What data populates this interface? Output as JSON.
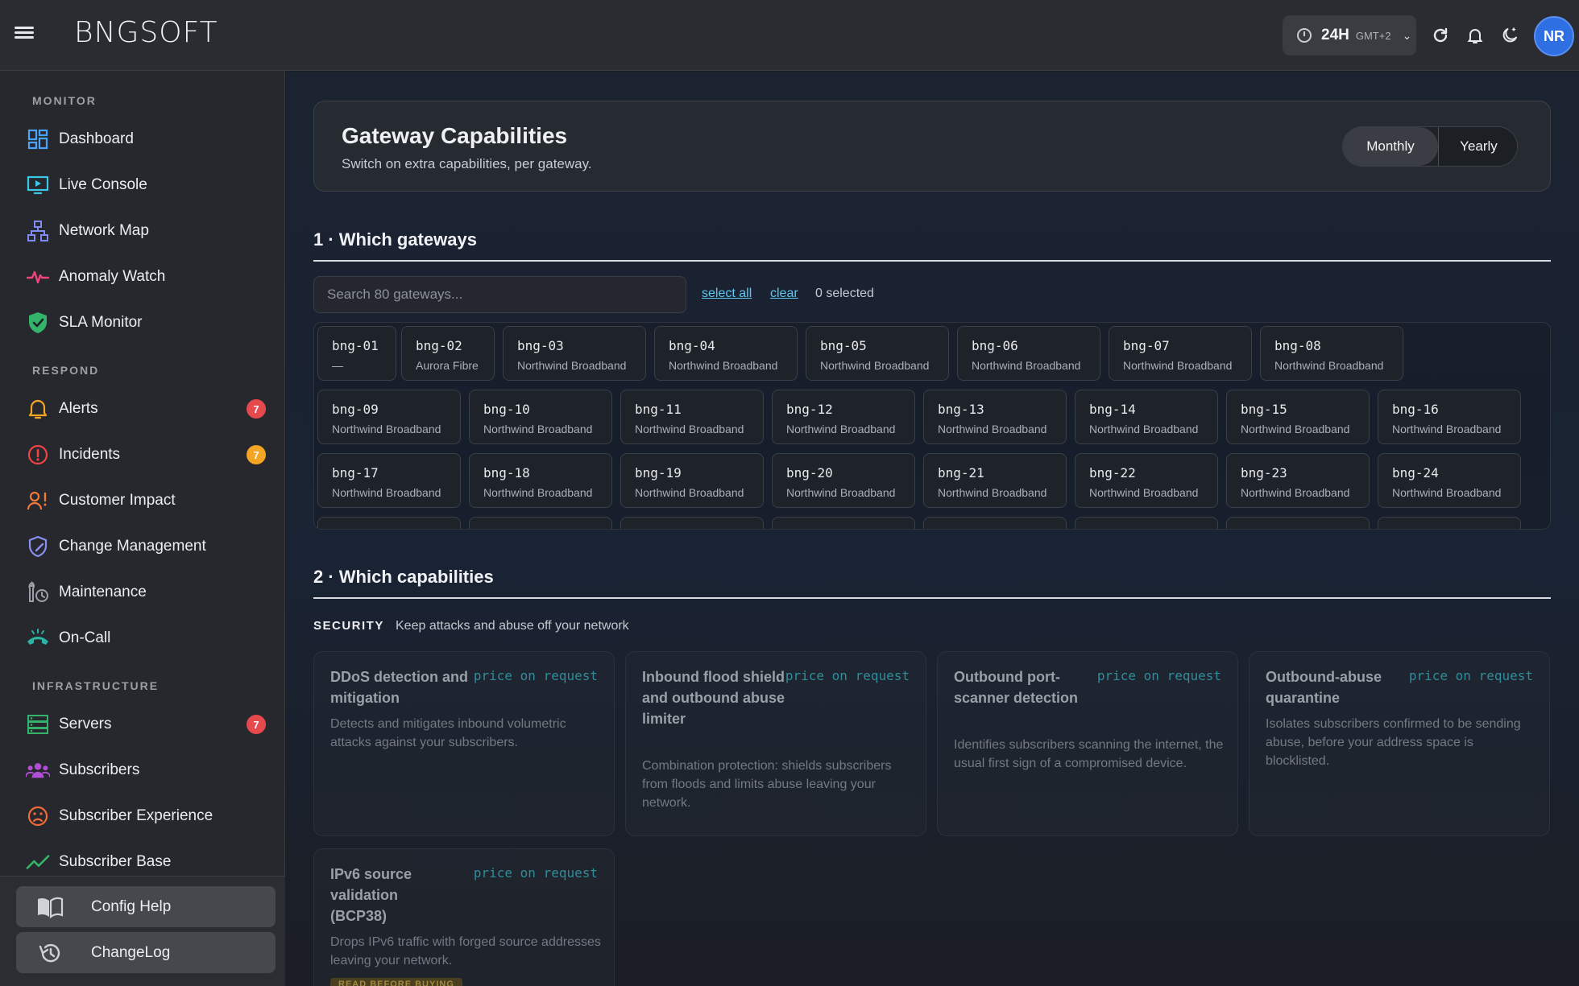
{
  "app": {
    "brand": "BNGSOFT"
  },
  "topbar": {
    "time_range": "24H",
    "timezone": "GMT+2",
    "avatar_initials": "NR"
  },
  "sidebar": {
    "sections": [
      {
        "title": "MONITOR"
      },
      {
        "title": "RESPOND"
      },
      {
        "title": "INFRASTRUCTURE"
      }
    ],
    "items": [
      {
        "label": "Dashboard",
        "icon": "dashboard-icon"
      },
      {
        "label": "Live Console",
        "icon": "monitor-play-icon"
      },
      {
        "label": "Network Map",
        "icon": "network-icon"
      },
      {
        "label": "Anomaly Watch",
        "icon": "pulse-icon"
      },
      {
        "label": "SLA Monitor",
        "icon": "shield-check-icon"
      },
      {
        "label": "Alerts",
        "icon": "bell-icon",
        "badge": "7",
        "badge_color": "#e5484d"
      },
      {
        "label": "Incidents",
        "icon": "alert-circle-icon",
        "badge": "7",
        "badge_color": "#f5a524"
      },
      {
        "label": "Customer Impact",
        "icon": "user-alert-icon"
      },
      {
        "label": "Change Management",
        "icon": "shield-edit-icon"
      },
      {
        "label": "Maintenance",
        "icon": "wrench-clock-icon"
      },
      {
        "label": "On-Call",
        "icon": "phone-icon"
      },
      {
        "label": "Servers",
        "icon": "server-icon",
        "badge": "7",
        "badge_color": "#e5484d"
      },
      {
        "label": "Subscribers",
        "icon": "users-icon"
      },
      {
        "label": "Subscriber Experience",
        "icon": "sad-face-icon"
      },
      {
        "label": "Subscriber Base",
        "icon": "trend-up-icon"
      }
    ],
    "bottom": [
      {
        "label": "Config Help",
        "icon": "book-icon"
      },
      {
        "label": "ChangeLog",
        "icon": "history-icon"
      }
    ]
  },
  "main": {
    "header": {
      "title": "Gateway Capabilities",
      "subtitle": "Switch on extra capabilities, per gateway.",
      "billing": {
        "options": [
          "Monthly",
          "Yearly"
        ],
        "selected": "Monthly"
      }
    },
    "step1": {
      "title": "1 · Which gateways",
      "search_placeholder": "Search 80 gateways...",
      "select_all": "select all",
      "clear": "clear",
      "selected_text": "0 selected",
      "gateways": [
        {
          "id": "bng-01",
          "operator": "—"
        },
        {
          "id": "bng-02",
          "operator": "Aurora Fibre"
        },
        {
          "id": "bng-03",
          "operator": "Northwind Broadband"
        },
        {
          "id": "bng-04",
          "operator": "Northwind Broadband"
        },
        {
          "id": "bng-05",
          "operator": "Northwind Broadband"
        },
        {
          "id": "bng-06",
          "operator": "Northwind Broadband"
        },
        {
          "id": "bng-07",
          "operator": "Northwind Broadband"
        },
        {
          "id": "bng-08",
          "operator": "Northwind Broadband"
        },
        {
          "id": "bng-09",
          "operator": "Northwind Broadband"
        },
        {
          "id": "bng-10",
          "operator": "Northwind Broadband"
        },
        {
          "id": "bng-11",
          "operator": "Northwind Broadband"
        },
        {
          "id": "bng-12",
          "operator": "Northwind Broadband"
        },
        {
          "id": "bng-13",
          "operator": "Northwind Broadband"
        },
        {
          "id": "bng-14",
          "operator": "Northwind Broadband"
        },
        {
          "id": "bng-15",
          "operator": "Northwind Broadband"
        },
        {
          "id": "bng-16",
          "operator": "Northwind Broadband"
        },
        {
          "id": "bng-17",
          "operator": "Northwind Broadband"
        },
        {
          "id": "bng-18",
          "operator": "Northwind Broadband"
        },
        {
          "id": "bng-19",
          "operator": "Northwind Broadband"
        },
        {
          "id": "bng-20",
          "operator": "Northwind Broadband"
        },
        {
          "id": "bng-21",
          "operator": "Northwind Broadband"
        },
        {
          "id": "bng-22",
          "operator": "Northwind Broadband"
        },
        {
          "id": "bng-23",
          "operator": "Northwind Broadband"
        },
        {
          "id": "bng-24",
          "operator": "Northwind Broadband"
        }
      ]
    },
    "step2": {
      "title": "2 · Which capabilities",
      "category": {
        "name": "SECURITY",
        "description": "Keep attacks and abuse off your network"
      },
      "capabilities": [
        {
          "title": "DDoS detection and mitigation",
          "price": "price on request",
          "description": "Detects and mitigates inbound volumetric attacks against your subscribers."
        },
        {
          "title": "Inbound flood shield and outbound abuse limiter",
          "price": "price on request",
          "description": "Combination protection: shields subscribers from floods and limits abuse leaving your network."
        },
        {
          "title": "Outbound port-scanner detection",
          "price": "price on request",
          "description": "Identifies subscribers scanning the internet, the usual first sign of a compromised device."
        },
        {
          "title": "Outbound-abuse quarantine",
          "price": "price on request",
          "description": "Isolates subscribers confirmed to be sending abuse, before your address space is blocklisted."
        },
        {
          "title": "IPv6 source validation (BCP38)",
          "price": "price on request",
          "description": "Drops IPv6 traffic with forged source addresses leaving your network.",
          "tag": "READ BEFORE BUYING"
        }
      ]
    }
  }
}
